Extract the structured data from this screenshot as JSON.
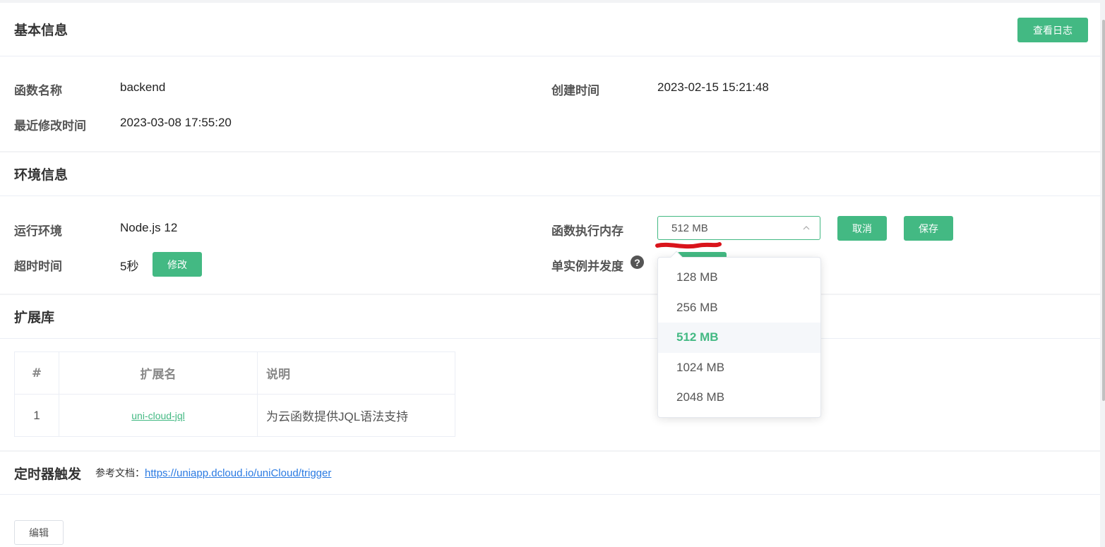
{
  "basic": {
    "title": "基本信息",
    "view_log_label": "查看日志",
    "func_name_label": "函数名称",
    "func_name_value": "backend",
    "created_label": "创建时间",
    "created_value": "2023-02-15 15:21:48",
    "modified_label": "最近修改时间",
    "modified_value": "2023-03-08 17:55:20"
  },
  "env": {
    "title": "环境信息",
    "runtime_label": "运行环境",
    "runtime_value": "Node.js 12",
    "memory_label": "函数执行内存",
    "memory_value": "512 MB",
    "cancel_label": "取消",
    "save_label": "保存",
    "timeout_label": "超时时间",
    "timeout_value": "5秒",
    "modify_label": "修改",
    "concurrency_label": "单实例并发度",
    "help_glyph": "?"
  },
  "dropdown": {
    "options": [
      "128 MB",
      "256 MB",
      "512 MB",
      "1024 MB",
      "2048 MB"
    ],
    "selected": "512 MB"
  },
  "extensions": {
    "title": "扩展库",
    "columns": [
      "#",
      "扩展名",
      "说明"
    ],
    "rows": [
      {
        "index": "1",
        "name": "uni-cloud-jql",
        "description": "为云函数提供JQL语法支持"
      }
    ]
  },
  "timer": {
    "title": "定时器触发",
    "ref_label": "参考文档：",
    "ref_link": "https://uniapp.dcloud.io/uniCloud/trigger",
    "edit_label": "编辑"
  },
  "colors": {
    "primary": "#43b983",
    "link": "#2a7ae2",
    "annotation": "#d9141b"
  }
}
